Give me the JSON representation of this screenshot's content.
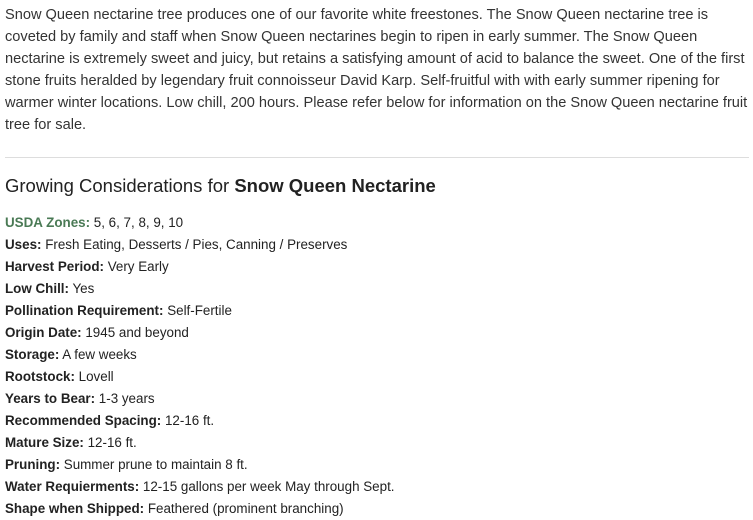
{
  "intro": {
    "text": "Snow Queen nectarine tree produces one of our favorite white freestones. The Snow Queen nectarine tree is coveted by family and staff when Snow Queen nectarines begin to ripen in early summer. The Snow Queen nectarine is extremely sweet and juicy,  but retains a satisfying amount of acid to balance the sweet. One of the first stone fruits heralded by legendary fruit connoisseur David Karp. Self-fruitful with with early summer ripening for warmer winter locations.  Low chill, 200 hours. Please refer below for information on the Snow Queen nectarine fruit tree for sale."
  },
  "heading": {
    "prefix": "Growing Considerations for ",
    "product": "Snow Queen Nectarine"
  },
  "colors": {
    "link_green": "#4a7a55",
    "divider": "#dddddd"
  },
  "specs": [
    {
      "label": "USDA Zones:",
      "value": " 5, 6, 7, 8, 9, 10"
    },
    {
      "label": "Uses:",
      "value": " Fresh Eating, Desserts / Pies, Canning / Preserves"
    },
    {
      "label": "Harvest Period:",
      "value": " Very Early"
    },
    {
      "label": "Low Chill:",
      "value": " Yes"
    },
    {
      "label": "Pollination Requirement:",
      "value": " Self-Fertile"
    },
    {
      "label": "Origin Date:",
      "value": " 1945 and beyond"
    },
    {
      "label": "Storage:",
      "value": " A few weeks"
    },
    {
      "label": "Rootstock:",
      "value": " Lovell"
    },
    {
      "label": "Years to Bear:",
      "value": " 1-3 years"
    },
    {
      "label": "Recommended Spacing:",
      "value": " 12-16 ft."
    },
    {
      "label": "Mature Size:",
      "value": " 12-16 ft."
    },
    {
      "label": "Pruning:",
      "value": " Summer prune to maintain 8 ft."
    },
    {
      "label": "Water Requierments:",
      "value": " 12-15 gallons per week May through Sept."
    },
    {
      "label": "Shape when Shipped:",
      "value": " Feathered (prominent branching)"
    }
  ]
}
